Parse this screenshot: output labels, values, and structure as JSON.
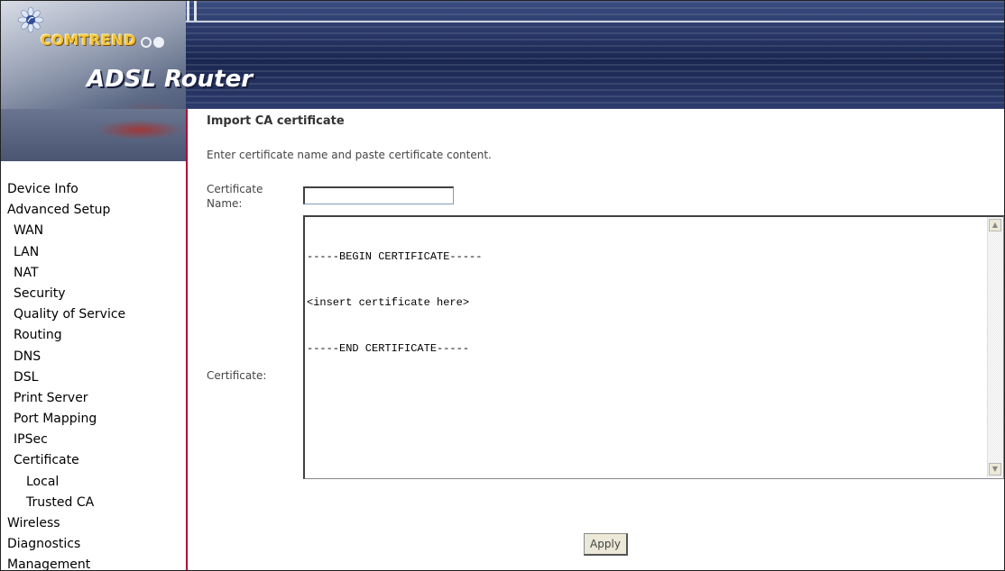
{
  "brand": {
    "company": "COMTREND",
    "product": "ADSL Router"
  },
  "nav": {
    "items": [
      {
        "label": "Device Info",
        "level": 0
      },
      {
        "label": "Advanced Setup",
        "level": 0
      },
      {
        "label": "WAN",
        "level": 1
      },
      {
        "label": "LAN",
        "level": 1
      },
      {
        "label": "NAT",
        "level": 1
      },
      {
        "label": "Security",
        "level": 1
      },
      {
        "label": "Quality of Service",
        "level": 1
      },
      {
        "label": "Routing",
        "level": 1
      },
      {
        "label": "DNS",
        "level": 1
      },
      {
        "label": "DSL",
        "level": 1
      },
      {
        "label": "Print Server",
        "level": 1
      },
      {
        "label": "Port Mapping",
        "level": 1
      },
      {
        "label": "IPSec",
        "level": 1
      },
      {
        "label": "Certificate",
        "level": 1
      },
      {
        "label": "Local",
        "level": 2
      },
      {
        "label": "Trusted CA",
        "level": 2
      },
      {
        "label": "Wireless",
        "level": 0
      },
      {
        "label": "Diagnostics",
        "level": 0
      },
      {
        "label": "Management",
        "level": 0
      }
    ]
  },
  "main": {
    "title": "Import CA certificate",
    "description": "Enter certificate name and paste certificate content.",
    "cert_name_label": "Certificate Name:",
    "cert_name_value": "",
    "certificate_label": "Certificate:",
    "certificate_lines": [
      "-----BEGIN CERTIFICATE-----",
      "<insert certificate here>",
      "-----END CERTIFICATE-----"
    ],
    "apply_label": "Apply"
  },
  "icons": {
    "logo": "flower-logo-icon",
    "scroll_up": "scroll-up-arrow-icon",
    "scroll_down": "scroll-down-arrow-icon"
  }
}
